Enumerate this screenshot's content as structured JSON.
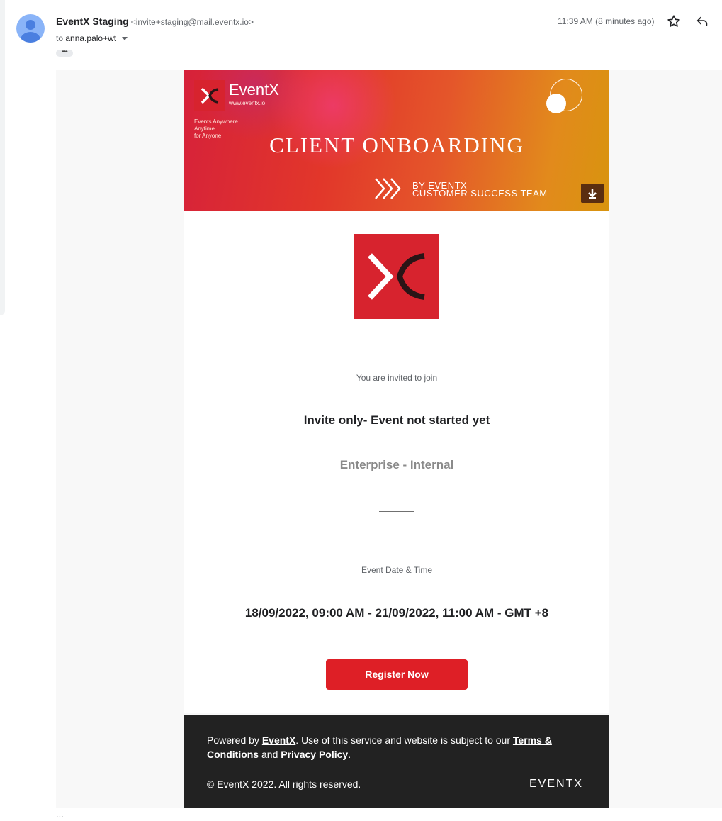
{
  "header": {
    "sender_name": "EventX Staging",
    "sender_email": "<invite+staging@mail.eventx.io>",
    "to_prefix": "to",
    "recipient": "anna.palo+wt",
    "timestamp": "11:39 AM (8 minutes ago)",
    "more_label": "•••"
  },
  "banner": {
    "brand": "EventX",
    "site": "www.eventx.io",
    "tagline_1": "Events Anywhere",
    "tagline_2": "Anytime",
    "tagline_3": "for Anyone",
    "headline": "CLIENT ONBOARDING",
    "by_1": "BY EVENTX",
    "by_2": "CUSTOMER SUCCESS TEAM"
  },
  "body": {
    "invite_text": "You are invited to join",
    "event_name": "Invite only- Event not started yet",
    "org_name": "Enterprise - Internal",
    "datetime_label": "Event Date & Time",
    "datetime_value": "18/09/2022, 09:00 AM - 21/09/2022, 11:00 AM - GMT +8",
    "register_label": "Register Now"
  },
  "footer": {
    "powered_by": "Powered by ",
    "eventx_link": "EventX",
    "use_text": ". Use of this service and website is subject to our ",
    "terms_link": "Terms & Conditions",
    "and_text": " and ",
    "privacy_link": "Privacy Policy",
    "period": ".",
    "copyright": "© EventX 2022. All rights reserved.",
    "wordmark": "EVENTX"
  },
  "trimmed_indicator": "...",
  "colors": {
    "brand_red": "#de1f26",
    "footer_bg": "#222222",
    "banner_orange": "#e28a1c"
  }
}
